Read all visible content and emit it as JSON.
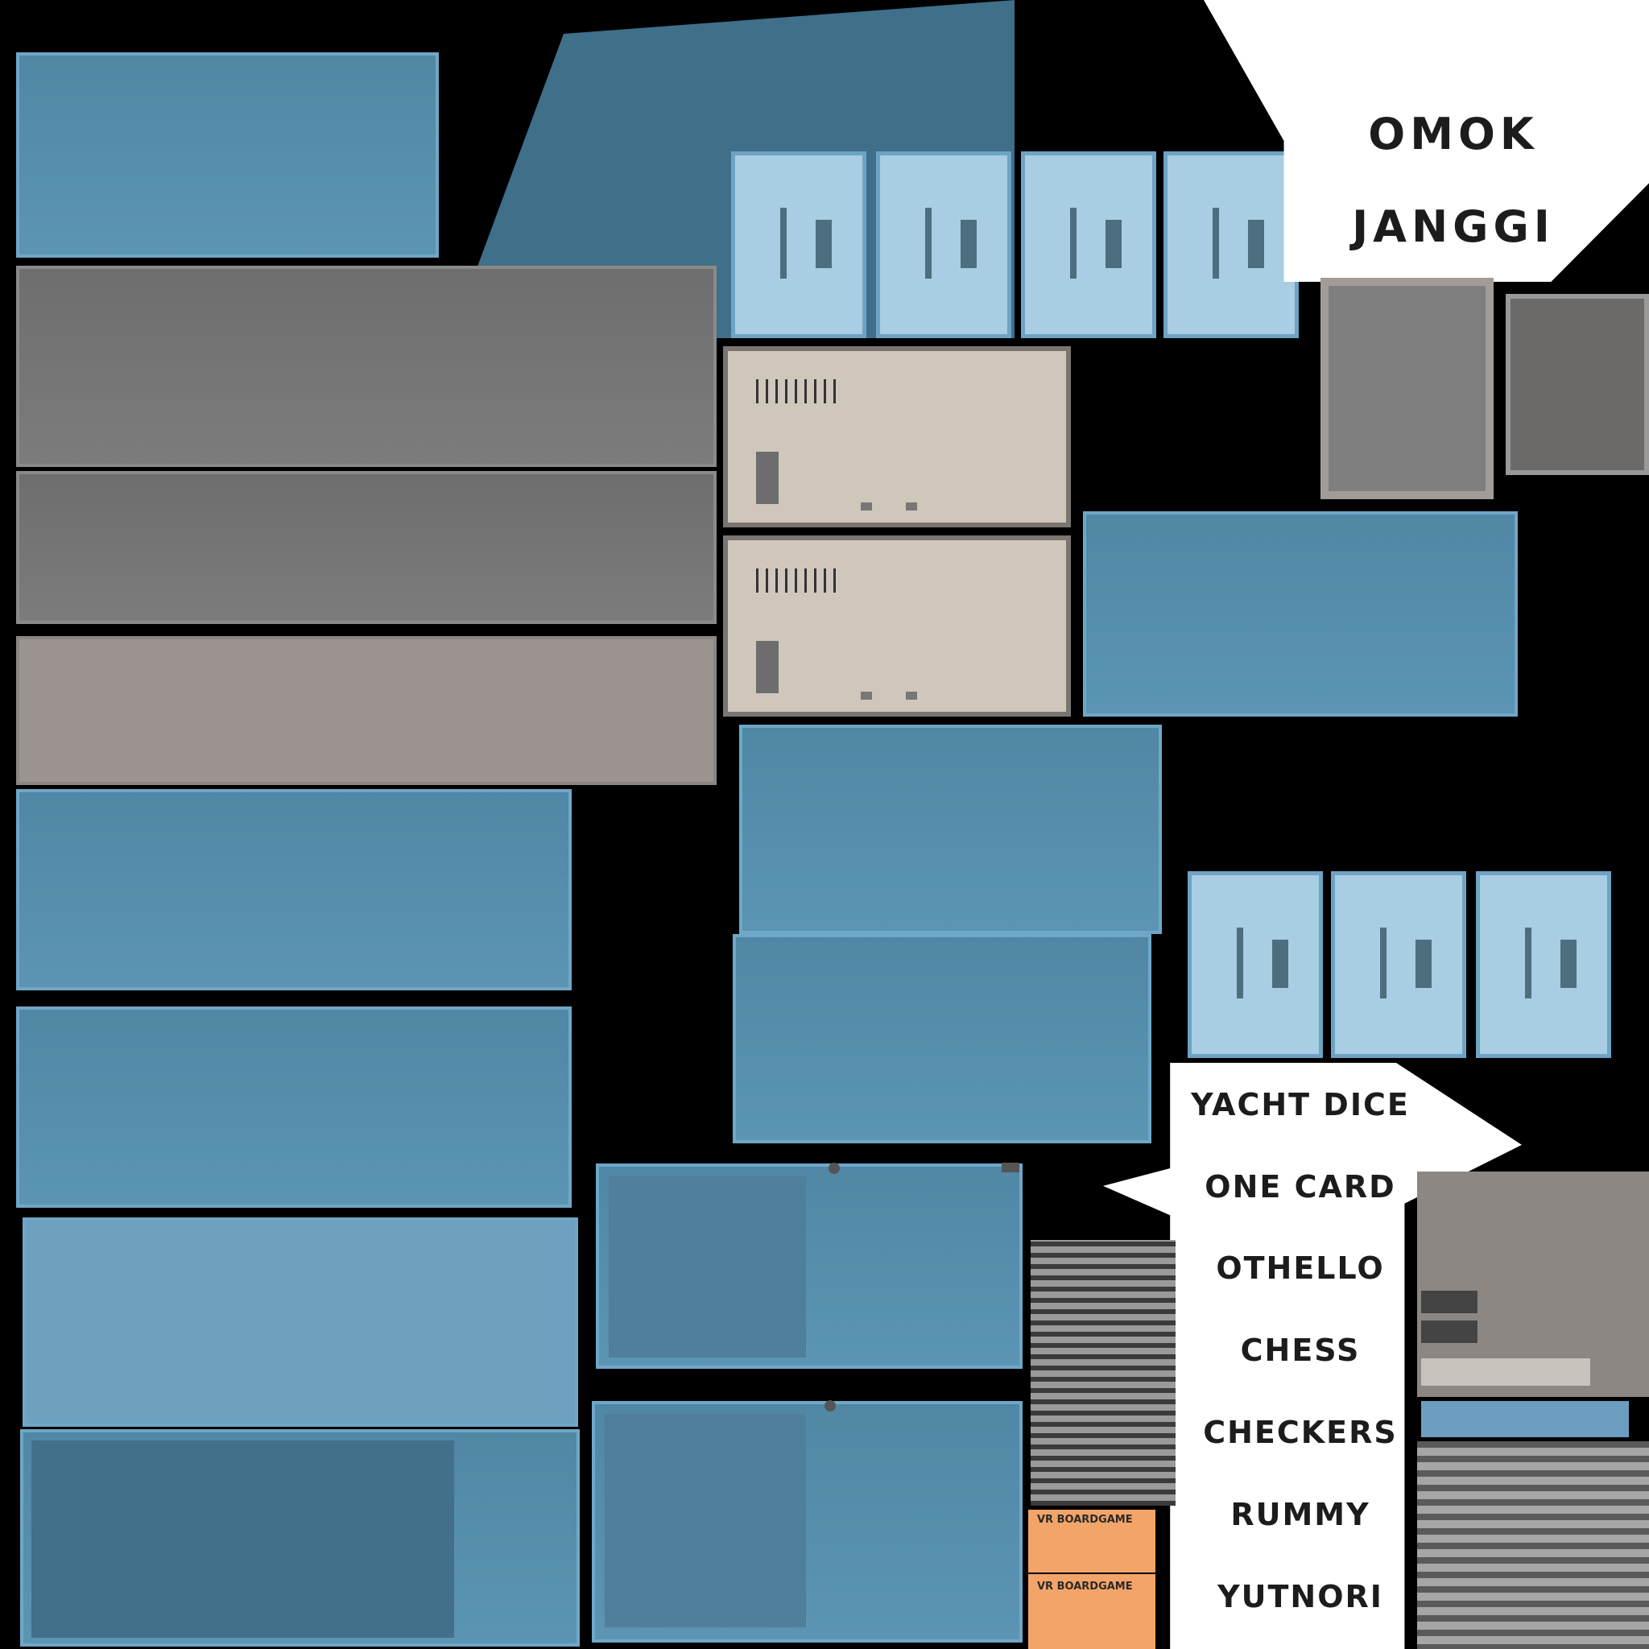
{
  "colors": {
    "background": "#000000",
    "blue": "#5c94b3",
    "grey": "#777777",
    "beige": "#cfc7bb",
    "tile": "#a9cde2",
    "label_bg": "#ffffff",
    "tag_bg": "#f3a468"
  },
  "top_labels": [
    "OMOK",
    "JANGGI"
  ],
  "game_list": [
    "YACHT DICE",
    "ONE CARD",
    "OTHELLO",
    "CHESS",
    "CHECKERS",
    "RUMMY",
    "YUTNORI"
  ],
  "tags": [
    "VR BOARDGAME",
    "VR BOARDGAME"
  ]
}
